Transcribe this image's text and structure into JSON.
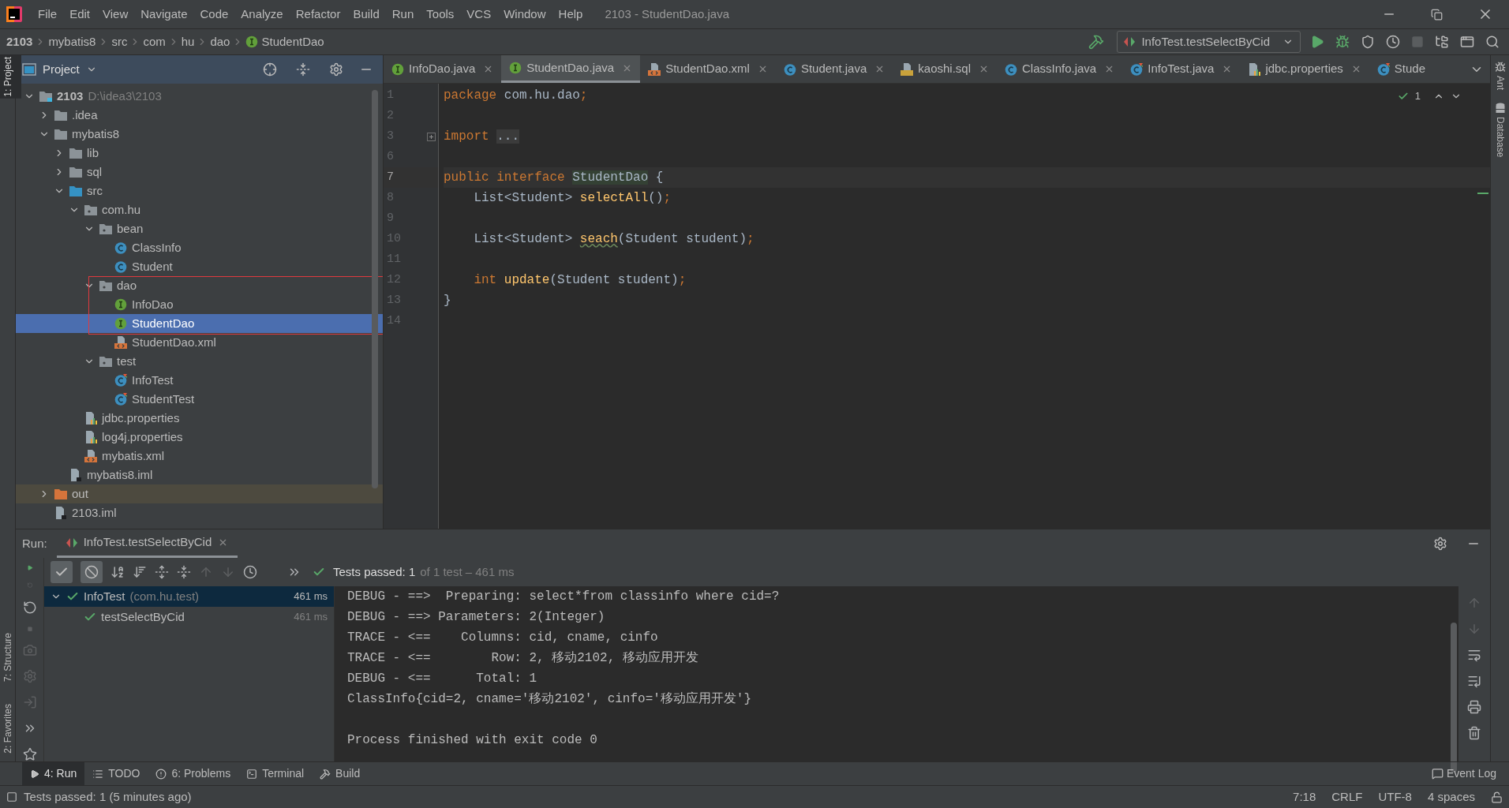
{
  "menu_bar": {
    "items": [
      "File",
      "Edit",
      "View",
      "Navigate",
      "Code",
      "Analyze",
      "Refactor",
      "Build",
      "Run",
      "Tools",
      "VCS",
      "Window",
      "Help"
    ],
    "title": "2103 - StudentDao.java"
  },
  "breadcrumbs": [
    {
      "label": "2103",
      "kind": "project"
    },
    {
      "label": "mybatis8",
      "kind": "folder"
    },
    {
      "label": "src",
      "kind": "folder"
    },
    {
      "label": "com",
      "kind": "folder"
    },
    {
      "label": "hu",
      "kind": "folder"
    },
    {
      "label": "dao",
      "kind": "folder"
    },
    {
      "label": "StudentDao",
      "kind": "interface"
    }
  ],
  "run_config": {
    "label": "InfoTest.testSelectByCid"
  },
  "side_tabs": {
    "left_top": [
      {
        "label": "1: Project",
        "selected": true
      }
    ],
    "left_bottom": [
      {
        "label": "7: Structure",
        "selected": false
      },
      {
        "label": "2: Favorites",
        "selected": false
      }
    ],
    "right": [
      {
        "label": "Ant"
      },
      {
        "label": "Database"
      }
    ]
  },
  "project_panel": {
    "title": "Project",
    "tree": [
      {
        "label": "2103",
        "detail": "D:\\idea3\\2103",
        "kind": "module",
        "selected": false,
        "expanded": true,
        "children": [
          {
            "label": ".idea",
            "kind": "folder",
            "selected": false,
            "expanded": false
          },
          {
            "label": "mybatis8",
            "kind": "folder",
            "selected": false,
            "expanded": true,
            "children": [
              {
                "label": "lib",
                "kind": "folder",
                "selected": false,
                "expanded": false
              },
              {
                "label": "sql",
                "kind": "folder",
                "selected": false,
                "expanded": false
              },
              {
                "label": "src",
                "kind": "source-folder",
                "selected": false,
                "expanded": true,
                "children": [
                  {
                    "label": "com.hu",
                    "kind": "package",
                    "selected": false,
                    "expanded": true,
                    "children": [
                      {
                        "label": "bean",
                        "kind": "package",
                        "selected": false,
                        "expanded": true,
                        "children": [
                          {
                            "label": "ClassInfo",
                            "kind": "class",
                            "selected": false
                          },
                          {
                            "label": "Student",
                            "kind": "class",
                            "selected": false
                          }
                        ]
                      },
                      {
                        "label": "dao",
                        "kind": "package",
                        "selected": false,
                        "expanded": true,
                        "children": [
                          {
                            "label": "InfoDao",
                            "kind": "interface",
                            "selected": false
                          },
                          {
                            "label": "StudentDao",
                            "kind": "interface",
                            "selected": true
                          },
                          {
                            "label": "StudentDao.xml",
                            "kind": "xml",
                            "selected": false
                          }
                        ]
                      },
                      {
                        "label": "test",
                        "kind": "package",
                        "selected": false,
                        "expanded": true,
                        "children": [
                          {
                            "label": "InfoTest",
                            "kind": "test-class",
                            "selected": false
                          },
                          {
                            "label": "StudentTest",
                            "kind": "test-class",
                            "selected": false
                          }
                        ]
                      }
                    ]
                  },
                  {
                    "label": "jdbc.properties",
                    "kind": "properties",
                    "selected": false
                  },
                  {
                    "label": "log4j.properties",
                    "kind": "properties",
                    "selected": false
                  },
                  {
                    "label": "mybatis.xml",
                    "kind": "xml",
                    "selected": false
                  }
                ]
              },
              {
                "label": "mybatis8.iml",
                "kind": "iml",
                "selected": false
              }
            ]
          },
          {
            "label": "out",
            "kind": "excluded-folder",
            "selected": false,
            "expanded": false
          },
          {
            "label": "2103.iml",
            "kind": "iml",
            "selected": false
          }
        ]
      }
    ]
  },
  "editor": {
    "tabs": [
      {
        "label": "InfoDao.java",
        "kind": "interface",
        "selected": false
      },
      {
        "label": "StudentDao.java",
        "kind": "interface",
        "selected": true
      },
      {
        "label": "StudentDao.xml",
        "kind": "xml",
        "selected": false
      },
      {
        "label": "Student.java",
        "kind": "class",
        "selected": false
      },
      {
        "label": "kaoshi.sql",
        "kind": "sql",
        "selected": false
      },
      {
        "label": "ClassInfo.java",
        "kind": "class",
        "selected": false
      },
      {
        "label": "InfoTest.java",
        "kind": "test-class",
        "selected": false
      },
      {
        "label": "jdbc.properties",
        "kind": "properties",
        "selected": false
      },
      {
        "label": "Stude",
        "kind": "test-class",
        "selected": false
      }
    ],
    "inspection_count": "1",
    "lines": [
      {
        "number": "1",
        "current": false,
        "tokens": [
          {
            "text": "package",
            "kind": "keyword"
          },
          {
            "text": " com.hu.dao",
            "kind": "plain"
          },
          {
            "text": ";",
            "kind": "punct"
          }
        ]
      },
      {
        "number": "2",
        "current": false
      },
      {
        "number": "3",
        "current": false,
        "tokens": [
          {
            "text": "import ",
            "kind": "keyword"
          },
          {
            "text": "...",
            "kind": "folded"
          }
        ]
      },
      {
        "number": "6",
        "current": false
      },
      {
        "number": "7",
        "current": true,
        "tokens": [
          {
            "text": "public interface ",
            "kind": "keyword"
          },
          {
            "text": "StudentDao",
            "kind": "declaration"
          },
          {
            "text": " {",
            "kind": "plain"
          }
        ]
      },
      {
        "number": "8",
        "current": false,
        "tokens": [
          {
            "text": "    List<Student> ",
            "kind": "plain"
          },
          {
            "text": "selectAll",
            "kind": "method"
          },
          {
            "text": "()",
            "kind": "plain"
          },
          {
            "text": ";",
            "kind": "punct"
          }
        ]
      },
      {
        "number": "9",
        "current": false
      },
      {
        "number": "10",
        "current": false,
        "tokens": [
          {
            "text": "    List<Student> ",
            "kind": "plain"
          },
          {
            "text": "seach",
            "kind": "typo-method"
          },
          {
            "text": "(Student student)",
            "kind": "plain"
          },
          {
            "text": ";",
            "kind": "punct"
          }
        ]
      },
      {
        "number": "11",
        "current": false
      },
      {
        "number": "12",
        "current": false,
        "tokens": [
          {
            "text": "    int ",
            "kind": "keyword"
          },
          {
            "text": "update",
            "kind": "method"
          },
          {
            "text": "(Student student)",
            "kind": "plain"
          },
          {
            "text": ";",
            "kind": "punct"
          }
        ]
      },
      {
        "number": "13",
        "current": false,
        "tokens": [
          {
            "text": "}",
            "kind": "plain"
          }
        ]
      },
      {
        "number": "14",
        "current": false
      }
    ]
  },
  "run_panel": {
    "label": "Run:",
    "tabs": [
      {
        "label": "InfoTest.testSelectByCid",
        "selected": true
      }
    ],
    "filters": [
      {
        "kind": "passed",
        "pressed": true
      },
      {
        "kind": "ignored",
        "pressed": true
      }
    ],
    "status": "Tests passed: 1",
    "status_detail": "of 1 test – 461 ms",
    "tests": [
      {
        "name": "InfoTest",
        "detail": "(com.hu.test)",
        "duration": "461 ms",
        "passed": true,
        "selected": true,
        "expanded": true,
        "children": [
          {
            "name": "testSelectByCid",
            "duration": "461 ms",
            "passed": true,
            "selected": false
          }
        ]
      }
    ],
    "console": [
      {
        "text": "DEBUG - ==>  Preparing: select*from classinfo where cid=?",
        "kind": "log"
      },
      {
        "text": "DEBUG - ==> Parameters: 2(Integer)",
        "kind": "log"
      },
      {
        "text": "TRACE - <==    Columns: cid, cname, cinfo",
        "kind": "log"
      },
      {
        "text": "TRACE - <==        Row: 2, 移动2102, 移动应用开发",
        "kind": "log"
      },
      {
        "text": "DEBUG - <==      Total: 1",
        "kind": "log"
      },
      {
        "text": "ClassInfo{cid=2, cname='移动2102', cinfo='移动应用开发'}",
        "kind": "log"
      },
      {
        "text": "Process finished with exit code 0",
        "kind": "exit"
      }
    ]
  },
  "tool_tabs": [
    {
      "label": "4: Run",
      "kind": "run",
      "selected": true
    },
    {
      "label": "TODO",
      "kind": "todo",
      "selected": false
    },
    {
      "label": "6: Problems",
      "kind": "problems",
      "selected": false
    },
    {
      "label": "Terminal",
      "kind": "terminal",
      "selected": false
    },
    {
      "label": "Build",
      "kind": "build",
      "selected": false
    }
  ],
  "event_log": "Event Log",
  "status_bar": {
    "message": "Tests passed: 1 (5 minutes ago)",
    "items": [
      "7:18",
      "CRLF",
      "UTF-8",
      "4 spaces"
    ]
  }
}
